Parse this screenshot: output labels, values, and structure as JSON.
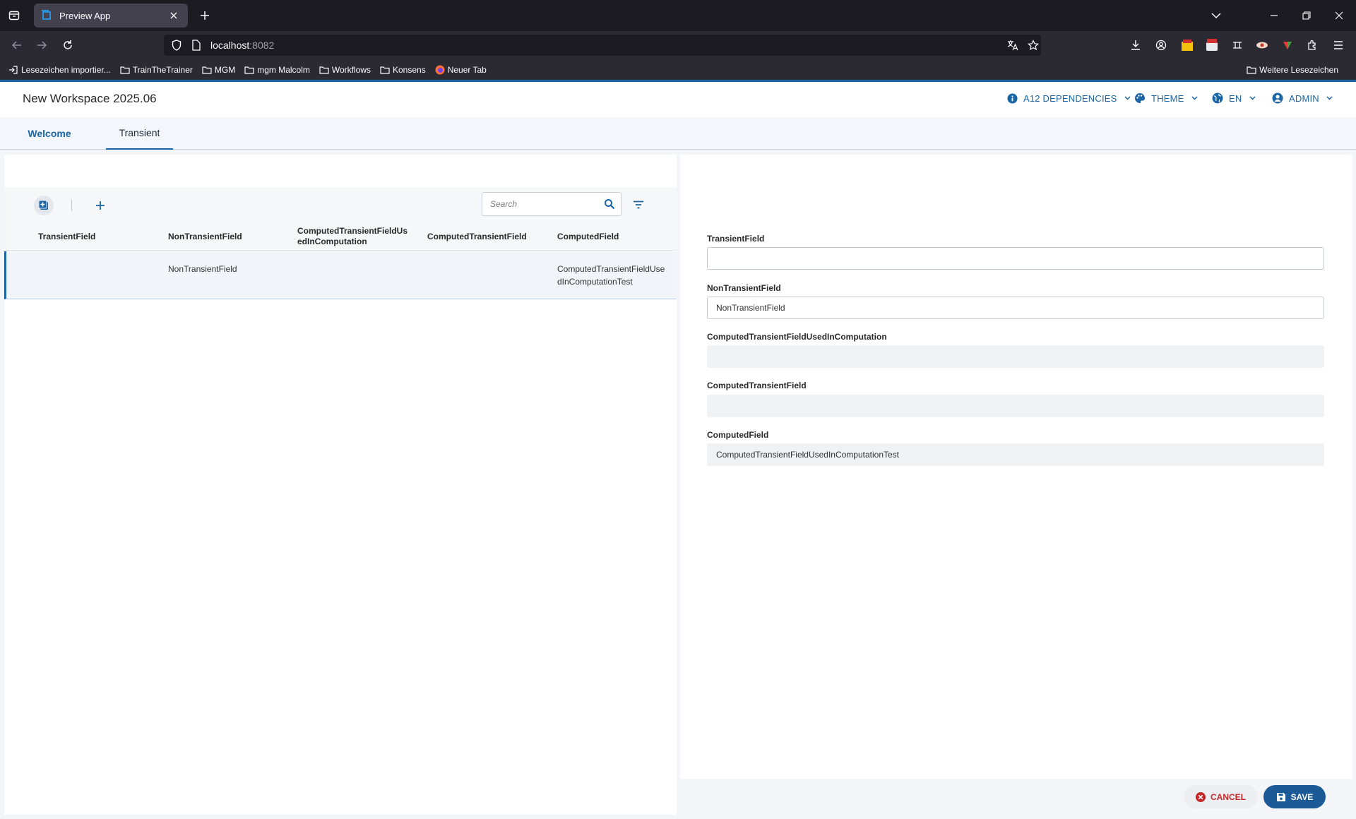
{
  "browser": {
    "tab_title": "Preview App",
    "url_host": "localhost",
    "url_port": ":8082",
    "bookmarks": [
      {
        "label": "Lesezeichen importier...",
        "icon": "import-icon"
      },
      {
        "label": "TrainTheTrainer",
        "icon": "folder-icon"
      },
      {
        "label": "MGM",
        "icon": "folder-icon"
      },
      {
        "label": "mgm Malcolm",
        "icon": "folder-icon"
      },
      {
        "label": "Workflows",
        "icon": "folder-icon"
      },
      {
        "label": "Konsens",
        "icon": "folder-icon"
      },
      {
        "label": "Neuer Tab",
        "icon": "firefox-icon"
      }
    ],
    "other_bookmarks": "Weitere Lesezeichen"
  },
  "app": {
    "workspace_title": "New Workspace 2025.06",
    "menus": {
      "dependencies": "A12 DEPENDENCIES",
      "theme": "THEME",
      "language": "EN",
      "user": "ADMIN"
    },
    "tabs": [
      {
        "label": "Welcome",
        "active": false
      },
      {
        "label": "Transient",
        "active": true
      }
    ],
    "accent_color": "#1b64a5"
  },
  "list": {
    "search_placeholder": "Search",
    "columns": [
      "TransientField",
      "NonTransientField",
      "ComputedTransientFieldUsedInComputation",
      "ComputedTransientField",
      "ComputedField"
    ],
    "rows": [
      [
        "",
        "NonTransientField",
        "",
        "",
        "ComputedTransientFieldUsedInComputationTest"
      ]
    ]
  },
  "form": {
    "fields": [
      {
        "label": "TransientField",
        "value": "",
        "readonly": false
      },
      {
        "label": "NonTransientField",
        "value": "NonTransientField",
        "readonly": false
      },
      {
        "label": "ComputedTransientFieldUsedInComputation",
        "value": "",
        "readonly": true
      },
      {
        "label": "ComputedTransientField",
        "value": "",
        "readonly": true
      },
      {
        "label": "ComputedField",
        "value": "ComputedTransientFieldUsedInComputationTest",
        "readonly": true
      }
    ],
    "cancel_label": "CANCEL",
    "save_label": "SAVE"
  }
}
